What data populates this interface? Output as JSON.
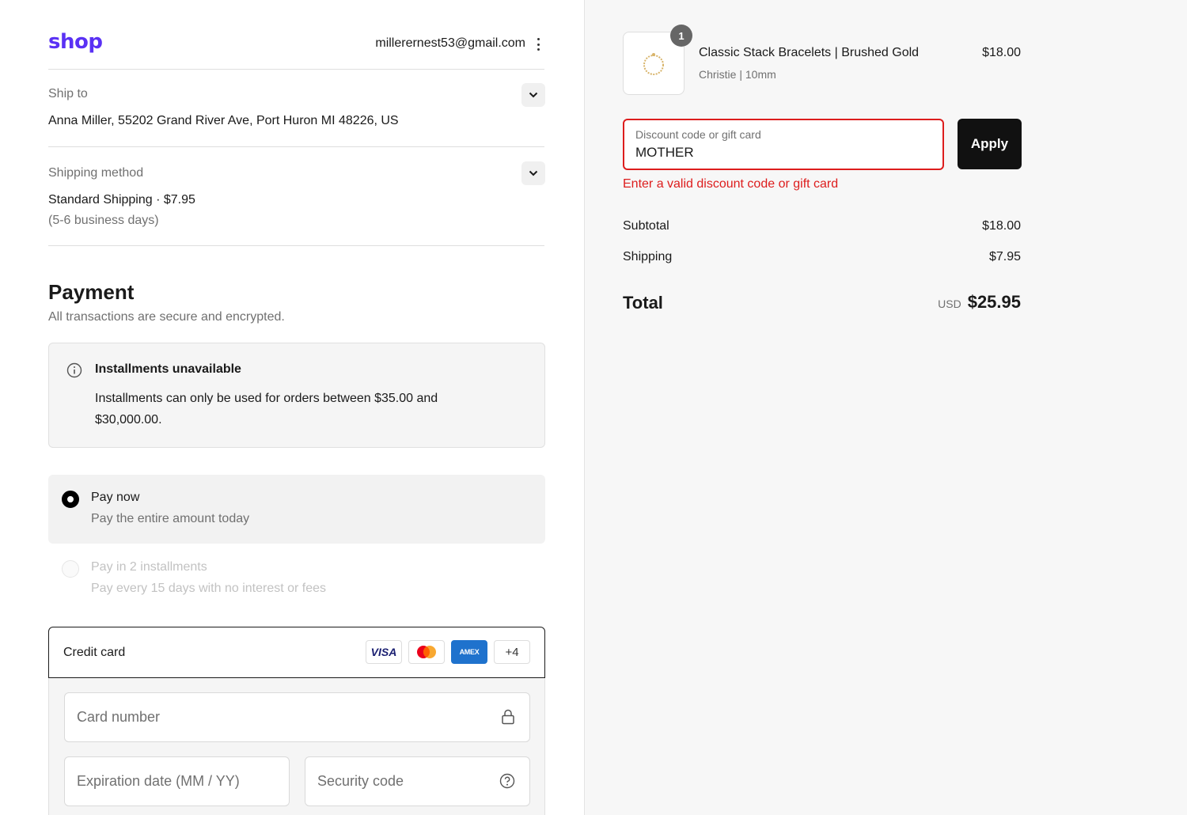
{
  "header": {
    "logo": "shop",
    "email": "millerernest53@gmail.com"
  },
  "ship_to": {
    "label": "Ship to",
    "value": "Anna Miller, 55202 Grand River Ave, Port Huron MI 48226, US"
  },
  "shipping_method": {
    "label": "Shipping method",
    "value": "Standard Shipping · $7.95",
    "sub": "(5-6 business days)"
  },
  "payment": {
    "title": "Payment",
    "subtitle": "All transactions are secure and encrypted.",
    "notice_title": "Installments unavailable",
    "notice_body": "Installments can only be used for orders between $35.00 and $30,000.00.",
    "options": [
      {
        "title": "Pay now",
        "sub": "Pay the entire amount today",
        "selected": true,
        "disabled": false
      },
      {
        "title": "Pay in 2 installments",
        "sub": "Pay every 15 days with no interest or fees",
        "selected": false,
        "disabled": true
      }
    ],
    "credit_card_label": "Credit card",
    "brands": {
      "visa": "VISA",
      "amex": "AMEX",
      "more": "+4"
    },
    "card_number_placeholder": "Card number",
    "expiration_placeholder": "Expiration date (MM / YY)",
    "security_placeholder": "Security code"
  },
  "summary": {
    "product": {
      "name": "Classic Stack Bracelets | Brushed Gold",
      "variant": "Christie | 10mm",
      "price": "$18.00",
      "quantity": "1"
    },
    "discount_label": "Discount code or gift card",
    "discount_value": "MOTHER",
    "apply_label": "Apply",
    "error": "Enter a valid discount code or gift card",
    "subtotal_label": "Subtotal",
    "subtotal_value": "$18.00",
    "shipping_label": "Shipping",
    "shipping_value": "$7.95",
    "total_label": "Total",
    "currency": "USD",
    "total_value": "$25.95"
  },
  "colors": {
    "brand": "#5a31f4",
    "error": "#dd1d1d",
    "button": "#111111",
    "summary_bg": "#f7f7f7"
  }
}
